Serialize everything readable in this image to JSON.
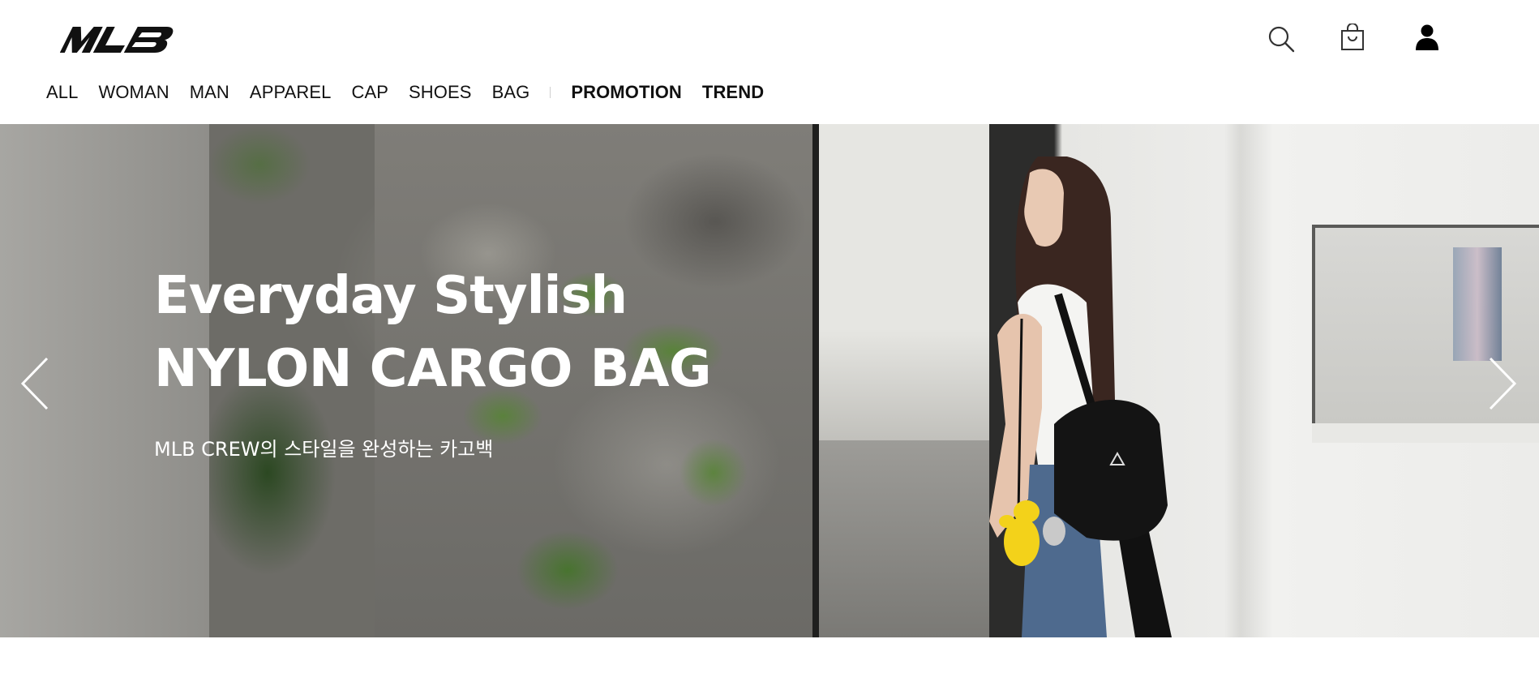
{
  "header": {
    "logo_text": "MLB",
    "icons": [
      "search-icon",
      "shopping-bag-icon",
      "user-icon"
    ]
  },
  "nav": {
    "items": [
      {
        "label": "ALL"
      },
      {
        "label": "WOMAN"
      },
      {
        "label": "MAN"
      },
      {
        "label": "APPAREL"
      },
      {
        "label": "CAP"
      },
      {
        "label": "SHOES"
      },
      {
        "label": "BAG"
      }
    ],
    "highlight_items": [
      {
        "label": "PROMOTION"
      },
      {
        "label": "TREND"
      }
    ]
  },
  "hero": {
    "title_line1": "Everyday Stylish",
    "title_line2": "NYLON CARGO BAG",
    "subtitle": "MLB CREW의 스타일을 완성하는 카고백",
    "prev_icon": "chevron-left-icon",
    "next_icon": "chevron-right-icon"
  },
  "colors": {
    "text": "#111111",
    "hero_text": "#ffffff",
    "background": "#ffffff"
  }
}
